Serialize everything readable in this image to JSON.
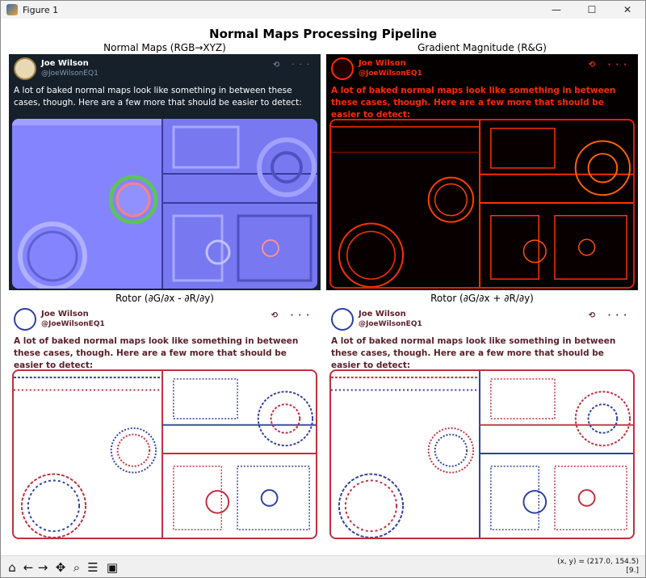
{
  "window": {
    "title": "Figure 1",
    "controls": {
      "minimize": "—",
      "maximize": "☐",
      "close": "✕"
    }
  },
  "figure": {
    "suptitle": "Normal Maps Processing Pipeline",
    "panels": [
      {
        "title": "Normal Maps (RGB→XYZ)"
      },
      {
        "title": "Gradient Magnitude (R&G)"
      },
      {
        "title": "Rotor (∂G/∂x - ∂R/∂y)"
      },
      {
        "title": "Rotor (∂G/∂x + ∂R/∂y)"
      }
    ],
    "tweet": {
      "name": "Joe Wilson",
      "handle": "@JoeWilsonEQ1",
      "icons": "⟲ ···",
      "text": "A lot of baked normal maps look like something in between these cases, though. Here are a few more that should be easier to detect:"
    }
  },
  "toolbar": {
    "home": "⌂",
    "back": "←",
    "forward": "→",
    "pan": "✥",
    "zoom": "⌕",
    "configure": "☰",
    "save": "▣",
    "coords_line1": "(x, y) = (217.0, 154.5)",
    "coords_line2": "[9.]"
  },
  "colors": {
    "normal_bg": "#7f80ff",
    "gradient_edge": "#ff2a00",
    "rotor_red": "#c03040",
    "rotor_blue": "#3040a0"
  }
}
